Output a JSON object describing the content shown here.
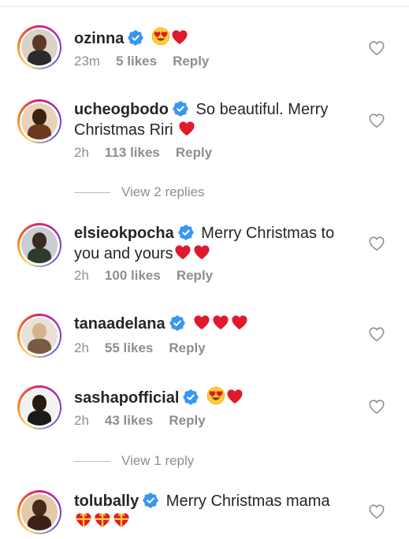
{
  "comments": [
    {
      "username": "ozinna",
      "verified": true,
      "text": "",
      "emoji": [
        "heart-eyes",
        "heart"
      ],
      "time": "23m",
      "likes": "5 likes",
      "reply": "Reply"
    },
    {
      "username": "ucheogbodo",
      "verified": true,
      "text": "So beautiful. Merry Christmas Riri",
      "emoji": [
        "heart"
      ],
      "time": "2h",
      "likes": "113 likes",
      "reply": "Reply"
    },
    {
      "username": "elsieokpocha",
      "verified": true,
      "text": "Merry Christmas to you and yours",
      "emoji": [
        "heart",
        "heart"
      ],
      "time": "2h",
      "likes": "100 likes",
      "reply": "Reply"
    },
    {
      "username": "tanaadelana",
      "verified": true,
      "text": "",
      "emoji": [
        "heart",
        "heart",
        "heart"
      ],
      "time": "2h",
      "likes": "55 likes",
      "reply": "Reply"
    },
    {
      "username": "sashapofficial",
      "verified": true,
      "text": "",
      "emoji": [
        "heart-eyes",
        "heart"
      ],
      "time": "2h",
      "likes": "43 likes",
      "reply": "Reply"
    },
    {
      "username": "tolubally",
      "verified": true,
      "text": "Merry Christmas mama",
      "emoji": [
        "gift-heart",
        "gift-heart",
        "gift-heart"
      ]
    }
  ],
  "view_replies": [
    "View 2 replies",
    "View 1 reply"
  ],
  "colors": {
    "verified": "#3897f0",
    "heart": "#e0192c",
    "muted": "#8e8e8e",
    "text": "#262626"
  }
}
